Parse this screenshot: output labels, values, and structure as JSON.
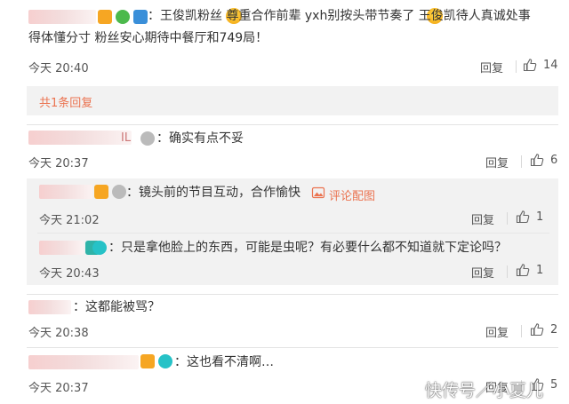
{
  "comments": [
    {
      "text_line1": "：王俊凯粉丝  尊重合作前辈 yxh别按头带节奏了  王俊凯待人真诚处事",
      "text_line2": "得体懂分寸 粉丝安心期待中餐厅和749局！",
      "time": "今天 20:40",
      "reply_label": "回复",
      "likes": "14",
      "more_replies": "共1条回复"
    },
    {
      "suffix": "IL",
      "text": "：确实有点不妥",
      "time": "今天 20:37",
      "reply_label": "回复",
      "likes": "6",
      "sub_replies": [
        {
          "text": "：镜头前的节目互动，合作愉快",
          "pic_link": "评论配图",
          "time": "今天 21:02",
          "reply_label": "回复",
          "likes": "1"
        },
        {
          "text": "：只是拿他脸上的东西，可能是虫呢？有必要什么都不知道就下定论吗？",
          "time": "今天 20:43",
          "reply_label": "回复",
          "likes": "1"
        }
      ]
    },
    {
      "text": "：这都能被骂？",
      "time": "今天 20:38",
      "reply_label": "回复",
      "likes": "2"
    },
    {
      "text": "：这也看不清啊…",
      "time": "今天 20:37",
      "reply_label": "回复",
      "likes": "5"
    }
  ],
  "watermark": "快传号／小夏儿",
  "colors": {
    "accent": "#eb7350",
    "panel": "#f2f2f2"
  }
}
